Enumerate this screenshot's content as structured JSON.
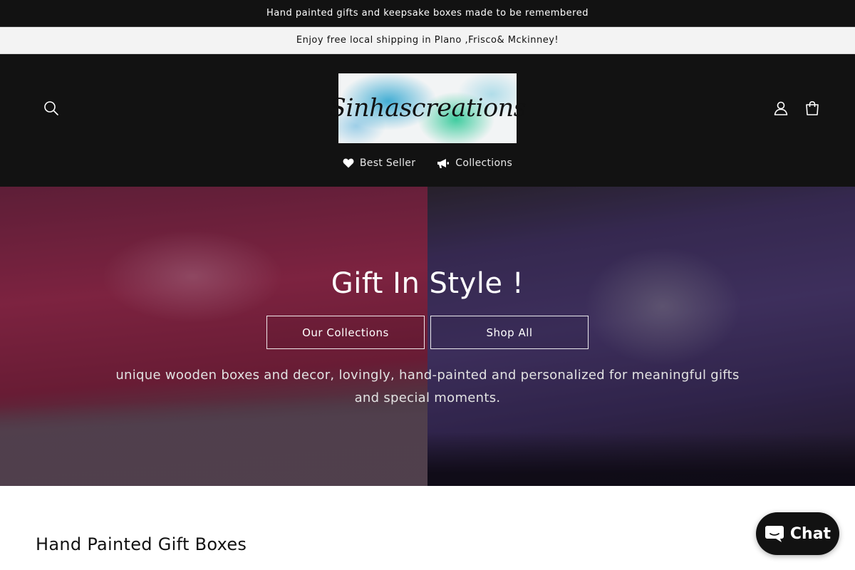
{
  "announcements": {
    "top": "Hand painted gifts and keepsake boxes made to be remembered",
    "second": "Enjoy free local shipping in Plano ,Frisco& Mckinney!"
  },
  "header": {
    "logo_text": "Sinhascreations",
    "icons": [
      "search-icon",
      "account-icon",
      "cart-icon"
    ]
  },
  "nav": {
    "items": [
      {
        "label": "Best Seller",
        "icon": "heart-icon"
      },
      {
        "label": "Collections",
        "icon": "megaphone-icon"
      }
    ]
  },
  "hero": {
    "title": "Gift In Style !",
    "buttons": [
      "Our Collections",
      "Shop All"
    ],
    "description": "unique wooden boxes and decor, lovingly, hand-painted and personalized for meaningful gifts and special moments."
  },
  "section": {
    "title": "Hand Painted Gift Boxes"
  },
  "chat": {
    "label": "Chat",
    "icon": "chat-bubble-icon"
  },
  "colors": {
    "header_bg": "#121212",
    "announcement_secondary_bg": "#f3f3f3",
    "page_bg": "#ffffff"
  }
}
